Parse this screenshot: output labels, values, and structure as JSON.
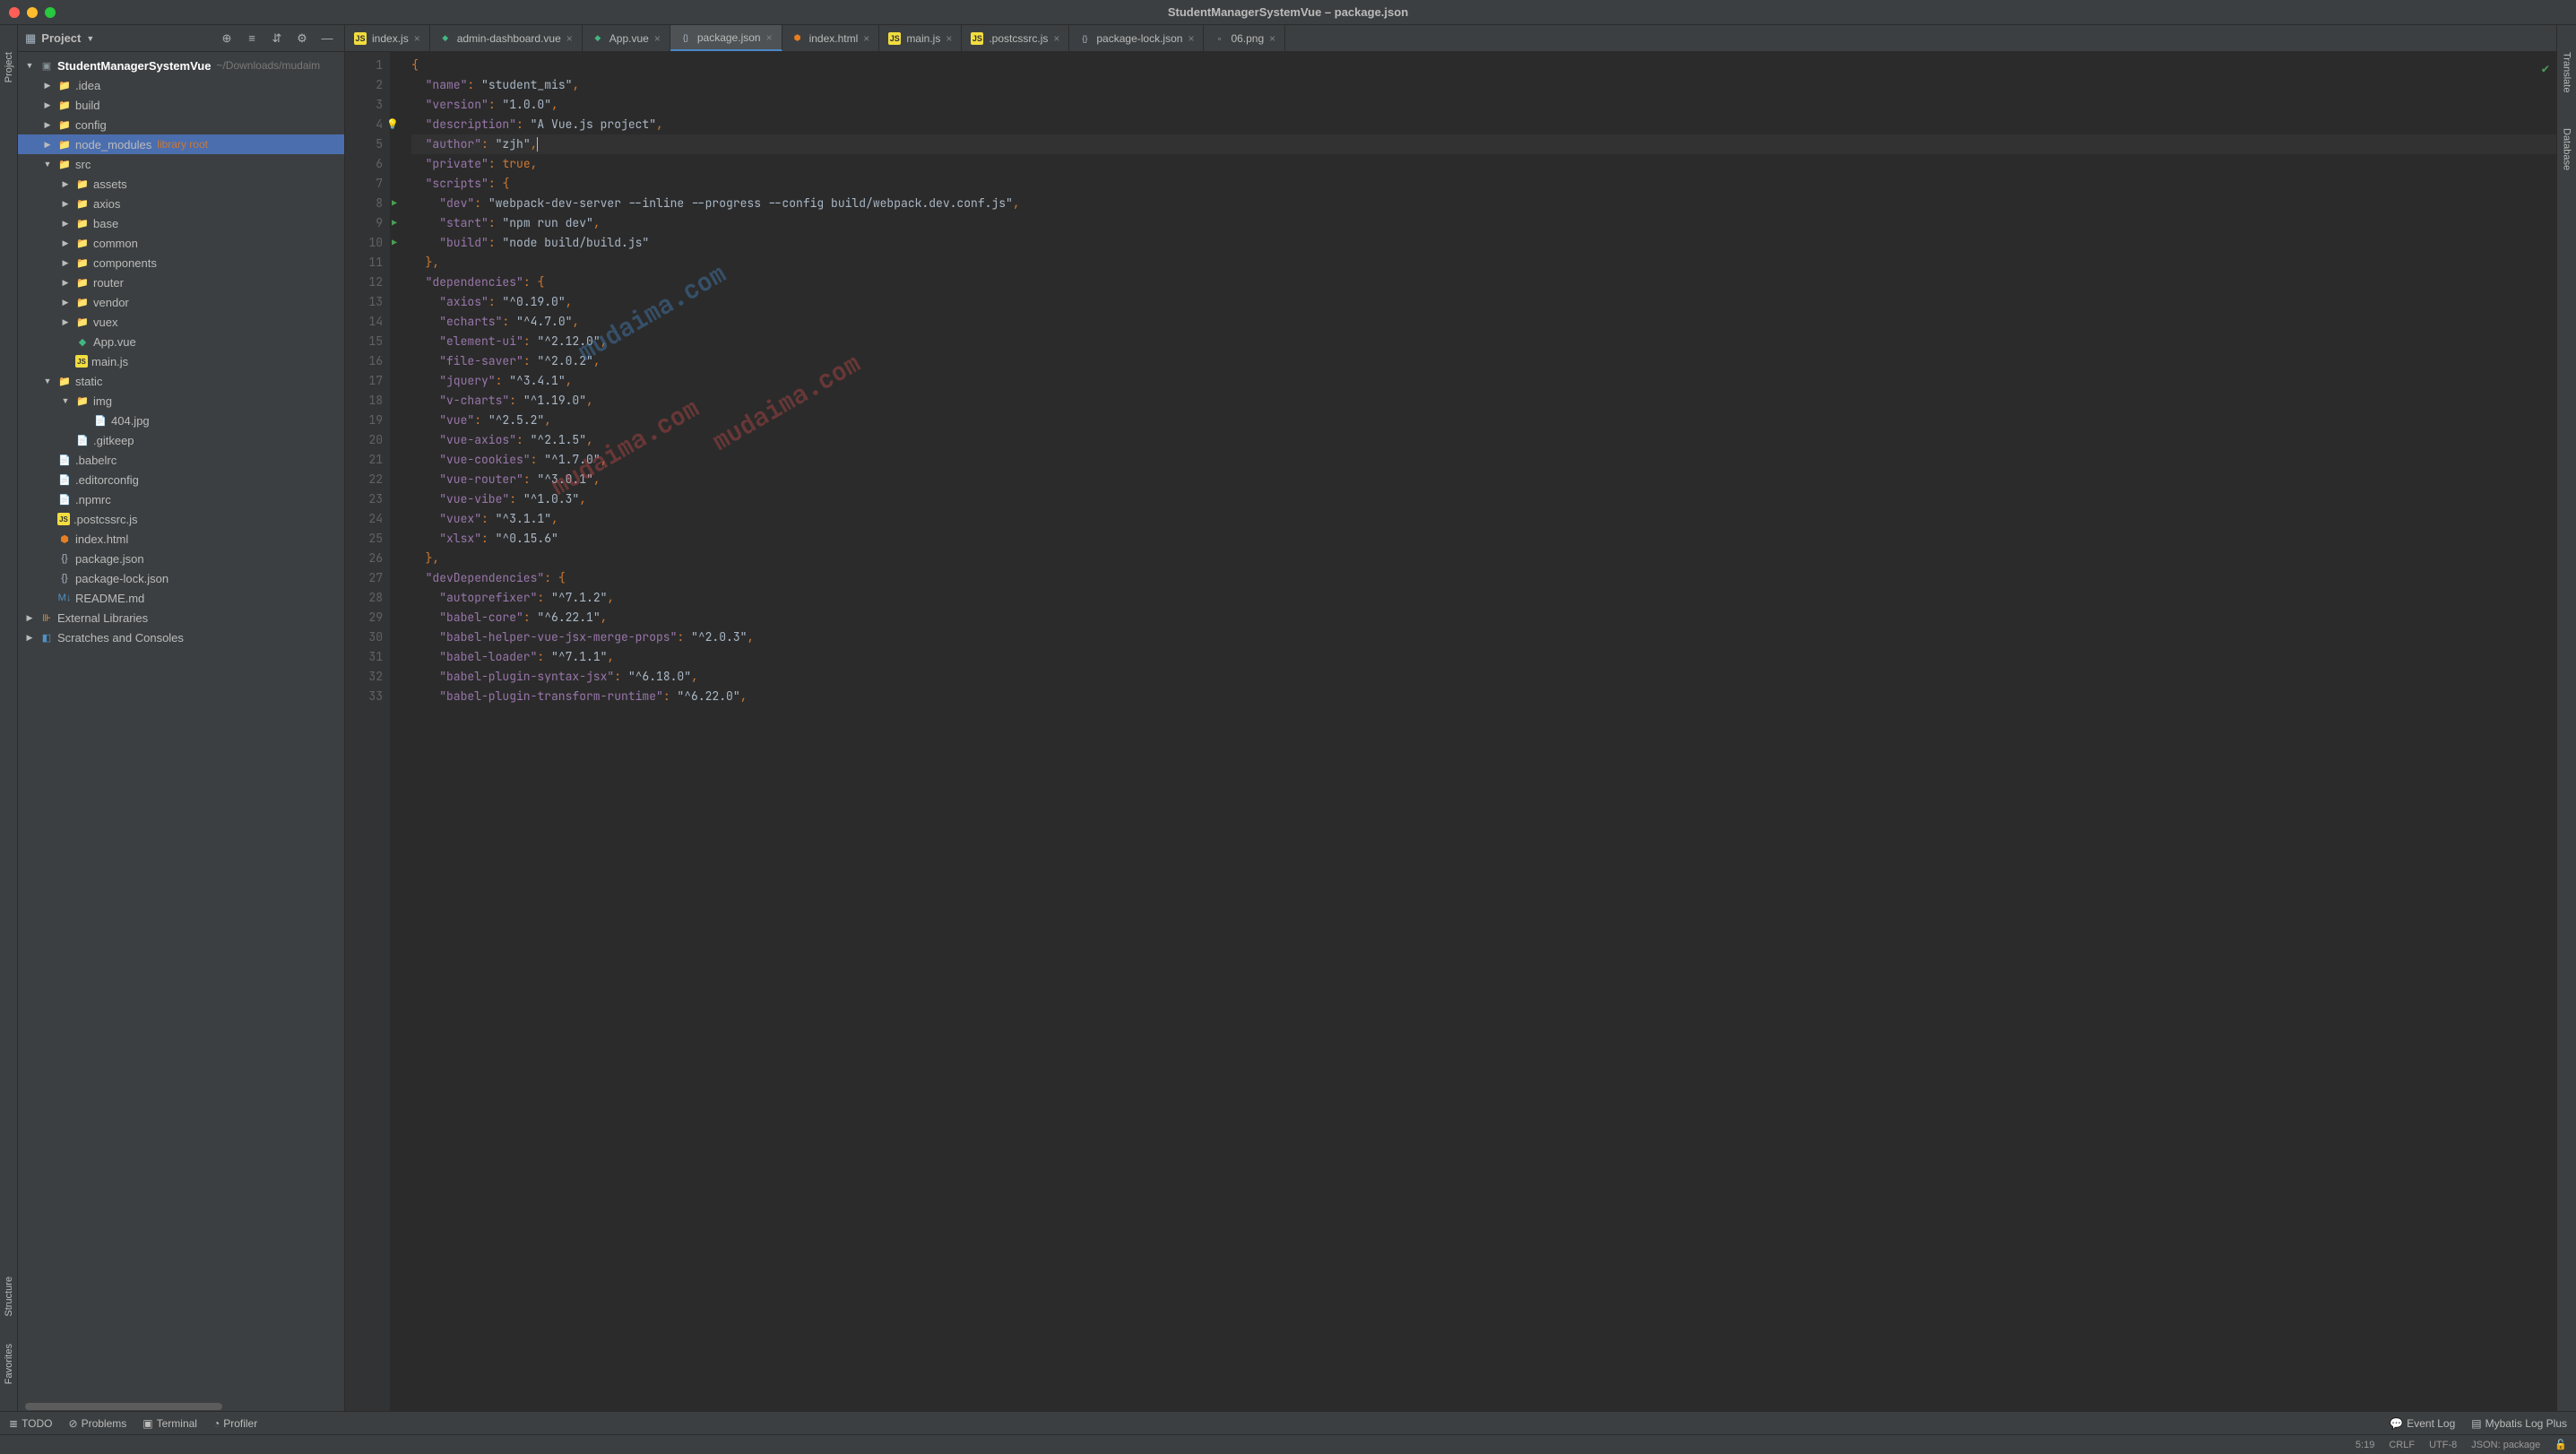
{
  "window": {
    "title": "StudentManagerSystemVue – package.json"
  },
  "sidebar": {
    "title": "Project",
    "root": {
      "name": "StudentManagerSystemVue",
      "path": "~/Downloads/mudaim"
    },
    "items": [
      {
        "label": ".idea",
        "type": "folder",
        "depth": 1
      },
      {
        "label": "build",
        "type": "folder",
        "depth": 1
      },
      {
        "label": "config",
        "type": "folder",
        "depth": 1
      },
      {
        "label": "node_modules",
        "type": "folder",
        "depth": 1,
        "lib": "library root",
        "selected": true
      },
      {
        "label": "src",
        "type": "folder",
        "depth": 1,
        "open": true
      },
      {
        "label": "assets",
        "type": "folder",
        "depth": 2
      },
      {
        "label": "axios",
        "type": "folder",
        "depth": 2
      },
      {
        "label": "base",
        "type": "folder",
        "depth": 2
      },
      {
        "label": "common",
        "type": "folder",
        "depth": 2
      },
      {
        "label": "components",
        "type": "folder",
        "depth": 2
      },
      {
        "label": "router",
        "type": "folder",
        "depth": 2
      },
      {
        "label": "vendor",
        "type": "folder",
        "depth": 2
      },
      {
        "label": "vuex",
        "type": "folder",
        "depth": 2
      },
      {
        "label": "App.vue",
        "type": "vue",
        "depth": 2,
        "noArrow": true
      },
      {
        "label": "main.js",
        "type": "js",
        "depth": 2,
        "noArrow": true
      },
      {
        "label": "static",
        "type": "folder",
        "depth": 1,
        "open": true
      },
      {
        "label": "img",
        "type": "folder",
        "depth": 2,
        "open": true
      },
      {
        "label": "404.jpg",
        "type": "file",
        "depth": 3,
        "noArrow": true
      },
      {
        "label": ".gitkeep",
        "type": "file",
        "depth": 2,
        "noArrow": true
      },
      {
        "label": ".babelrc",
        "type": "file",
        "depth": 1,
        "noArrow": true
      },
      {
        "label": ".editorconfig",
        "type": "file",
        "depth": 1,
        "noArrow": true
      },
      {
        "label": ".npmrc",
        "type": "file",
        "depth": 1,
        "noArrow": true
      },
      {
        "label": ".postcssrc.js",
        "type": "js",
        "depth": 1,
        "noArrow": true
      },
      {
        "label": "index.html",
        "type": "html",
        "depth": 1,
        "noArrow": true
      },
      {
        "label": "package.json",
        "type": "json",
        "depth": 1,
        "noArrow": true
      },
      {
        "label": "package-lock.json",
        "type": "json",
        "depth": 1,
        "noArrow": true
      },
      {
        "label": "README.md",
        "type": "md",
        "depth": 1,
        "noArrow": true
      }
    ],
    "extras": [
      {
        "label": "External Libraries"
      },
      {
        "label": "Scratches and Consoles"
      }
    ]
  },
  "tabs": [
    {
      "label": "index.js",
      "type": "js"
    },
    {
      "label": "admin-dashboard.vue",
      "type": "vue"
    },
    {
      "label": "App.vue",
      "type": "vue"
    },
    {
      "label": "package.json",
      "type": "json",
      "active": true
    },
    {
      "label": "index.html",
      "type": "html"
    },
    {
      "label": "main.js",
      "type": "js"
    },
    {
      "label": ".postcssrc.js",
      "type": "js"
    },
    {
      "label": "package-lock.json",
      "type": "json"
    },
    {
      "label": "06.png",
      "type": "file"
    }
  ],
  "code": {
    "lines": [
      "{",
      "  \"name\": \"student_mis\",",
      "  \"version\": \"1.0.0\",",
      "  \"description\": \"A Vue.js project\",",
      "  \"author\": \"zjh\",",
      "  \"private\": true,",
      "  \"scripts\": {",
      "    \"dev\": \"webpack-dev-server --inline --progress --config build/webpack.dev.conf.js\",",
      "    \"start\": \"npm run dev\",",
      "    \"build\": \"node build/build.js\"",
      "  },",
      "  \"dependencies\": {",
      "    \"axios\": \"^0.19.0\",",
      "    \"echarts\": \"^4.7.0\",",
      "    \"element-ui\": \"^2.12.0\",",
      "    \"file-saver\": \"^2.0.2\",",
      "    \"jquery\": \"^3.4.1\",",
      "    \"v-charts\": \"^1.19.0\",",
      "    \"vue\": \"^2.5.2\",",
      "    \"vue-axios\": \"^2.1.5\",",
      "    \"vue-cookies\": \"^1.7.0\",",
      "    \"vue-router\": \"^3.0.1\",",
      "    \"vue-vibe\": \"^1.0.3\",",
      "    \"vuex\": \"^3.1.1\",",
      "    \"xlsx\": \"^0.15.6\"",
      "  },",
      "  \"devDependencies\": {",
      "    \"autoprefixer\": \"^7.1.2\",",
      "    \"babel-core\": \"^6.22.1\",",
      "    \"babel-helper-vue-jsx-merge-props\": \"^2.0.3\",",
      "    \"babel-loader\": \"^7.1.1\",",
      "    \"babel-plugin-syntax-jsx\": \"^6.18.0\",",
      "    \"babel-plugin-transform-runtime\": \"^6.22.0\","
    ],
    "bulb_line": 4,
    "run_lines": [
      8,
      9,
      10
    ],
    "highlight_line": 5
  },
  "watermarks": {
    "wm1": "mudaima.com",
    "wm2": "mudaima.com",
    "wm3": "mudaima.com"
  },
  "bottom": {
    "todo": "TODO",
    "problems": "Problems",
    "terminal": "Terminal",
    "profiler": "Profiler",
    "eventlog": "Event Log",
    "mybatis": "Mybatis Log Plus"
  },
  "status": {
    "pos": "5:19",
    "lineend": "CRLF",
    "enc": "UTF-8",
    "lang": "JSON: package"
  },
  "rails": {
    "project": "Project",
    "structure": "Structure",
    "favorites": "Favorites",
    "translate": "Translate",
    "database": "Database"
  }
}
